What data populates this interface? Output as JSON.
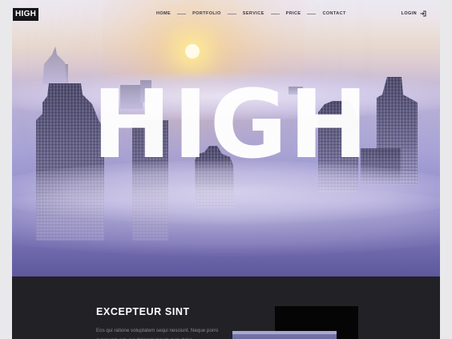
{
  "brand": {
    "logo": "HIGH"
  },
  "nav": {
    "items": [
      {
        "label": "HOME"
      },
      {
        "label": "PORTFOLIO"
      },
      {
        "label": "SERVICE"
      },
      {
        "label": "PRICE"
      },
      {
        "label": "CONTACT"
      }
    ],
    "login_label": "LOGIN",
    "login_icon": "login-icon"
  },
  "hero": {
    "title": "HIGH"
  },
  "section": {
    "title": "EXCEPTEUR SINT",
    "body": "Eos qui ratione voluptatem sequi nesciunt. Neque porro quisquam est, qui dolorem ipsum quia dolor"
  },
  "colors": {
    "accent_dark": "#222226",
    "hero_sky_top": "#ece9f2",
    "hero_fog": "#a7a3d6",
    "sun": "#fffbe8"
  }
}
